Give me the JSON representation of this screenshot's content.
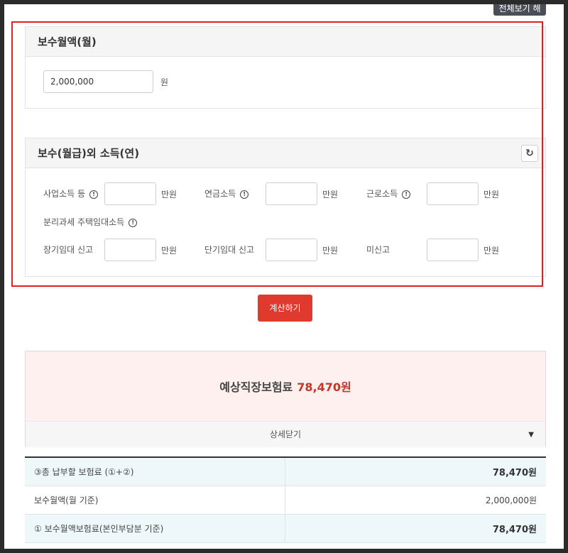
{
  "top_button": {
    "label": "전체보기 해"
  },
  "monthly_pay": {
    "title": "보수월액(월)",
    "value": "2,000,000",
    "unit": "원"
  },
  "other_income": {
    "title": "보수(월급)외 소득(연)",
    "refresh_icon": "↻",
    "info_icon": "!",
    "row1": [
      {
        "label": "사업소득 등",
        "value": "",
        "unit": "만원"
      },
      {
        "label": "연금소득",
        "value": "",
        "unit": "만원"
      },
      {
        "label": "근로소득",
        "value": "",
        "unit": "만원"
      }
    ],
    "rental_label": "분리과세 주택임대소득",
    "row2": [
      {
        "label": "장기임대 신고",
        "value": "",
        "unit": "만원"
      },
      {
        "label": "단기임대 신고",
        "value": "",
        "unit": "만원"
      },
      {
        "label": "미신고",
        "value": "",
        "unit": "만원"
      }
    ]
  },
  "calculate_button": {
    "label": "계산하기"
  },
  "result": {
    "label": "예상직장보험료",
    "amount": "78,470원",
    "detail_toggle": "상세닫기",
    "toggle_icon": "▼"
  },
  "detail_table": [
    {
      "label": "③총 납부할 보험료 (①+②)",
      "value": "78,470원",
      "highlight": true
    },
    {
      "label": "보수월액(월 기준)",
      "value": "2,000,000원",
      "highlight": false
    },
    {
      "label": "① 보수월액보험료(본인부담분 기준)",
      "value": "78,470원",
      "highlight": true
    }
  ]
}
